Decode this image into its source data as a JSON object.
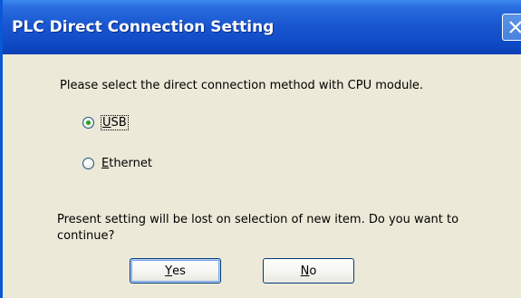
{
  "window": {
    "title": "PLC Direct Connection Setting"
  },
  "prompt": "Please select the direct connection method with CPU module.",
  "options": [
    {
      "mnemonic": "U",
      "rest": "SB",
      "selected": true
    },
    {
      "mnemonic": "E",
      "rest": "thernet",
      "selected": false
    }
  ],
  "question": "Present setting will be lost on selection of new item. Do you want to continue?",
  "buttons": {
    "yes": {
      "mnemonic": "Y",
      "rest": "es"
    },
    "no": {
      "mnemonic": "N",
      "rest": "o"
    }
  },
  "colors": {
    "titlebar": "#0f4bc6",
    "dialog_bg": "#ece9d8",
    "radio_dot": "#21a121"
  }
}
